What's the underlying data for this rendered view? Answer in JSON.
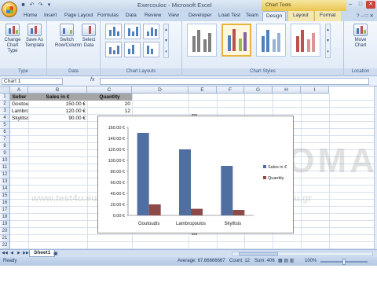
{
  "window": {
    "title": "Exercise.xlsx - Microsoft Excel",
    "title_display": "Εxercouloc - Microsoft Excel",
    "context_tab_group": "Chart Tools"
  },
  "ribbon_tabs": [
    {
      "label": "Home"
    },
    {
      "label": "Insert"
    },
    {
      "label": "Page Layout"
    },
    {
      "label": "Formulas"
    },
    {
      "label": "Data"
    },
    {
      "label": "Review"
    },
    {
      "label": "View"
    },
    {
      "label": "Developer"
    },
    {
      "label": "Load Test"
    },
    {
      "label": "Team"
    },
    {
      "label": "Design"
    },
    {
      "label": "Layout"
    },
    {
      "label": "Format"
    }
  ],
  "ribbon": {
    "type_group": {
      "label": "Type",
      "change_chart_type": "Change Chart Type",
      "save_as_template": "Save As Template"
    },
    "data_group": {
      "label": "Data",
      "switch_row_column": "Switch Row/Column",
      "select_data": "Select Data"
    },
    "layouts_group": {
      "label": "Chart Layouts"
    },
    "styles_group": {
      "label": "Chart Styles"
    },
    "location_group": {
      "label": "Location",
      "move_chart": "Move Chart"
    }
  },
  "formula_bar": {
    "name_box": "Chart 1",
    "fx": "fx",
    "content": ""
  },
  "columns": [
    "A",
    "B",
    "C",
    "D",
    "E",
    "F",
    "G",
    "H",
    "I"
  ],
  "rows": [
    "1",
    "2",
    "3",
    "4",
    "5",
    "6",
    "7",
    "8",
    "9",
    "10",
    "11",
    "12",
    "13",
    "14",
    "15",
    "16",
    "17",
    "18",
    "19",
    "20",
    "21",
    "22"
  ],
  "table": {
    "headers": [
      "Seller",
      "Sales in €",
      "Quantity"
    ],
    "rows": [
      [
        "Goutoudis",
        "150.00 €",
        "20"
      ],
      [
        "Lambropoulos",
        "120.00 €",
        "12"
      ],
      [
        "Skylitsis",
        "90.00 €",
        "10"
      ]
    ]
  },
  "chart_data": {
    "type": "bar",
    "categories": [
      "Goutoudis",
      "Lambropoulos",
      "Skylitsis"
    ],
    "series": [
      {
        "name": "Sales in €",
        "values": [
          150,
          120,
          90
        ],
        "color": "#4f6fa0"
      },
      {
        "name": "Quantity",
        "values": [
          20,
          12,
          10
        ],
        "color": "#8c4a48"
      }
    ],
    "ylim": [
      0,
      160
    ],
    "yticks": [
      "0.00 €",
      "20.00 €",
      "40.00 €",
      "60.00 €",
      "80.00 €",
      "100.00 €",
      "120.00 €",
      "140.00 €",
      "160.00 €"
    ],
    "legend": "right",
    "grid": false
  },
  "sheet_tabs": [
    {
      "label": "Sheet1"
    }
  ],
  "status_bar": {
    "ready": "Ready",
    "average": "Average: 67.66666667",
    "count": "Count: 12",
    "sum": "Sum: 406",
    "zoom": "100%"
  },
  "watermark": {
    "text1": "DIPLOMA",
    "text2": "www.test4u.eu",
    "text3": "www.diploma.edu.gr"
  }
}
